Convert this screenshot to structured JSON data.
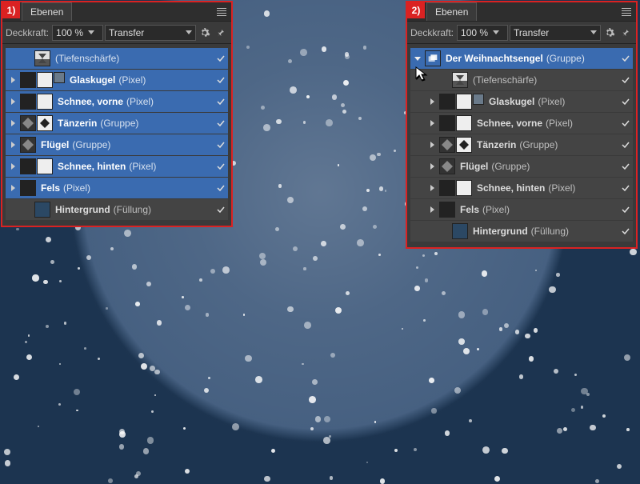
{
  "panels": {
    "title": "Ebenen",
    "opacity_label": "Deckkraft:",
    "opacity_value": "100 %",
    "blend_value": "Transfer",
    "badge1": "1)",
    "badge2": "2)"
  },
  "left": {
    "items": [
      {
        "name": "",
        "type": "(Tiefenschärfe)",
        "expand": "",
        "thumbs": [
          "depth"
        ],
        "sel": true,
        "indent": 1
      },
      {
        "name": "Glaskugel",
        "type": "(Pixel)",
        "expand": "right",
        "thumbs": [
          "dark",
          "white",
          "img-small"
        ],
        "sel": true,
        "indent": 0
      },
      {
        "name": "Schnee, vorne",
        "type": "(Pixel)",
        "expand": "right",
        "thumbs": [
          "dark",
          "white"
        ],
        "sel": true,
        "indent": 0
      },
      {
        "name": "Tänzerin",
        "type": "(Gruppe)",
        "expand": "right",
        "thumbs": [
          "img",
          "white-img"
        ],
        "sel": true,
        "indent": 0
      },
      {
        "name": "Flügel",
        "type": "(Gruppe)",
        "expand": "right",
        "thumbs": [
          "img"
        ],
        "sel": true,
        "indent": 0
      },
      {
        "name": "Schnee, hinten",
        "type": "(Pixel)",
        "expand": "right",
        "thumbs": [
          "dark",
          "white"
        ],
        "sel": true,
        "indent": 0
      },
      {
        "name": "Fels",
        "type": "(Pixel)",
        "expand": "right",
        "thumbs": [
          "dark"
        ],
        "sel": true,
        "indent": 0
      },
      {
        "name": "Hintergrund",
        "type": "(Füllung)",
        "expand": "",
        "thumbs": [
          "bluefill"
        ],
        "sel": false,
        "indent": 1
      }
    ]
  },
  "right": {
    "items": [
      {
        "name": "Der Weihnachtsengel",
        "type": "(Gruppe)",
        "expand": "down",
        "thumbs": [
          "group"
        ],
        "sel": true,
        "indent": 0
      },
      {
        "name": "",
        "type": "(Tiefenschärfe)",
        "expand": "",
        "thumbs": [
          "depth"
        ],
        "sel": false,
        "indent": 2
      },
      {
        "name": "Glaskugel",
        "type": "(Pixel)",
        "expand": "right",
        "thumbs": [
          "dark",
          "white",
          "img-small"
        ],
        "sel": false,
        "indent": 1
      },
      {
        "name": "Schnee, vorne",
        "type": "(Pixel)",
        "expand": "right",
        "thumbs": [
          "dark",
          "white"
        ],
        "sel": false,
        "indent": 1
      },
      {
        "name": "Tänzerin",
        "type": "(Gruppe)",
        "expand": "right",
        "thumbs": [
          "img",
          "white-img"
        ],
        "sel": false,
        "indent": 1
      },
      {
        "name": "Flügel",
        "type": "(Gruppe)",
        "expand": "right",
        "thumbs": [
          "img"
        ],
        "sel": false,
        "indent": 1
      },
      {
        "name": "Schnee, hinten",
        "type": "(Pixel)",
        "expand": "right",
        "thumbs": [
          "dark",
          "white"
        ],
        "sel": false,
        "indent": 1
      },
      {
        "name": "Fels",
        "type": "(Pixel)",
        "expand": "right",
        "thumbs": [
          "dark"
        ],
        "sel": false,
        "indent": 1
      },
      {
        "name": "Hintergrund",
        "type": "(Füllung)",
        "expand": "",
        "thumbs": [
          "bluefill"
        ],
        "sel": false,
        "indent": 2
      }
    ]
  }
}
